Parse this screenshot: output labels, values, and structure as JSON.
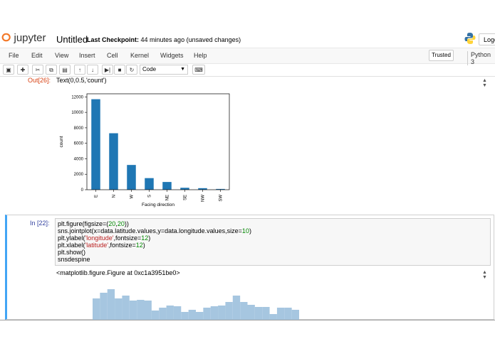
{
  "header": {
    "logo_text": "jupyter",
    "notebook_title": "Untitled",
    "checkpoint_label": "Last Checkpoint:",
    "checkpoint_time": "44 minutes ago",
    "checkpoint_status": "(unsaved changes)",
    "logout_label": "Logo"
  },
  "menubar": {
    "items": [
      "File",
      "Edit",
      "View",
      "Insert",
      "Cell",
      "Kernel",
      "Widgets",
      "Help"
    ],
    "trusted_label": "Trusted",
    "kernel_name": "Python 3"
  },
  "toolbar": {
    "buttons": [
      "save-icon",
      "plus-icon",
      "scissors-icon",
      "copy-icon",
      "paste-icon",
      "arrow-up-icon",
      "arrow-down-icon",
      "step-forward-icon",
      "stop-icon",
      "restart-icon"
    ],
    "cell_type": "Code",
    "keyboard_icon": "keyboard-icon"
  },
  "output_26": {
    "prompt": "Out[26]:",
    "text": "Text(0,0.5,'count')"
  },
  "chart_data": {
    "type": "bar",
    "categories": [
      "E",
      "N",
      "W",
      "S",
      "NE",
      "SE",
      "NW",
      "SW"
    ],
    "values": [
      11700,
      7300,
      3200,
      1500,
      1000,
      250,
      200,
      100
    ],
    "title": "",
    "xlabel": "Facing direction",
    "ylabel": "count",
    "ylim": [
      0,
      12400
    ],
    "yticks": [
      "0",
      "2000",
      "4000",
      "6000",
      "8000",
      "10000",
      "12000"
    ],
    "bar_color": "#1f77b4",
    "grid": false
  },
  "cell_22": {
    "prompt": "In  [22]:",
    "code": [
      "plt.figure(figsize=(20,20))",
      "sns.jointplot(x=data.latitude.values,y=data.longitude.values,size=10)",
      "plt.ylabel('longitude',fontsize=12)",
      "plt.xlabel('latitude',fontsize=12)",
      "plt.show()",
      "snsdespine"
    ],
    "output_text": "<matplotlib.figure.Figure  at  0xc1a3951be0>",
    "hist_color": "#a6c6e0"
  }
}
